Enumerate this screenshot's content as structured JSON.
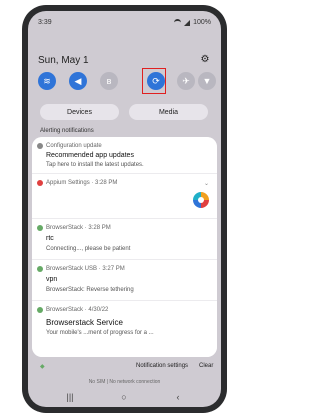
{
  "status_bar": {
    "time": "3:39",
    "battery": "100%"
  },
  "header": {
    "date": "Sun, May 1",
    "settings_icon": "gear-icon"
  },
  "quick_toggles": [
    {
      "name": "wifi",
      "icon": "wifi-icon",
      "state": "on"
    },
    {
      "name": "sound",
      "icon": "volume-icon",
      "state": "on"
    },
    {
      "name": "bluetooth",
      "icon": "bluetooth-icon",
      "state": "off"
    },
    {
      "name": "auto-rotate",
      "icon": "rotate-icon",
      "state": "on"
    },
    {
      "name": "airplane",
      "icon": "airplane-icon",
      "state": "off"
    },
    {
      "name": "flashlight",
      "icon": "flashlight-icon",
      "state": "off"
    }
  ],
  "tabs": {
    "devices": "Devices",
    "media": "Media"
  },
  "notifications": {
    "section_label": "Alerting notifications",
    "items": [
      {
        "app": "Configuration update",
        "title": "Recommended app updates",
        "body": "Tap here to install the latest updates."
      },
      {
        "app": "Appium Settings",
        "time": "3:28 PM"
      },
      {
        "app": "BrowserStack",
        "time": "3:28 PM",
        "title": "rtc",
        "body": "Connecting..., please be patient"
      },
      {
        "app": "BrowserStack USB",
        "time": "3:27 PM",
        "title": "vpn",
        "body": "BrowserStack: Reverse tethering"
      },
      {
        "app": "BrowserStack",
        "time": "4/30/22",
        "title": "Browserstack Service",
        "body": "Your mobile's ...ment of progress for a ..."
      }
    ],
    "footer": {
      "settings": "Notification settings",
      "clear": "Clear"
    }
  },
  "network_status": "No SIM | No network connection",
  "colors": {
    "toggle_on": "#2f74d8",
    "highlight": "#e02020"
  }
}
